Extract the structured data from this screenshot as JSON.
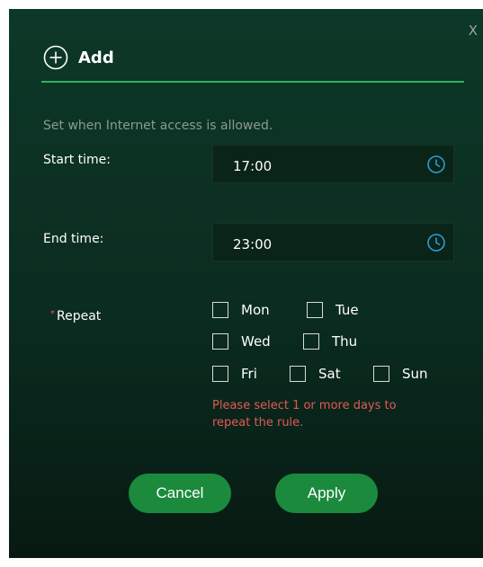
{
  "dialog": {
    "title": "Add",
    "close_label": "X",
    "intro": "Set when Internet access is allowed."
  },
  "start_time": {
    "label": "Start time:",
    "value": "17:00"
  },
  "end_time": {
    "label": "End time:",
    "value": "23:00"
  },
  "repeat": {
    "required_mark": "*",
    "label": "Repeat",
    "days": [
      {
        "label": "Mon",
        "checked": false
      },
      {
        "label": "Tue",
        "checked": false
      },
      {
        "label": "Wed",
        "checked": false
      },
      {
        "label": "Thu",
        "checked": false
      },
      {
        "label": "Fri",
        "checked": false
      },
      {
        "label": "Sat",
        "checked": false
      },
      {
        "label": "Sun",
        "checked": false
      }
    ],
    "error": "Please select 1 or more days to repeat the rule."
  },
  "buttons": {
    "cancel": "Cancel",
    "apply": "Apply"
  },
  "colors": {
    "accent": "#31b25a",
    "button": "#1b8a3d",
    "error": "#e25a55",
    "clock_icon": "#2a9dd6"
  },
  "icons": {
    "add": "plus-circle-icon",
    "time": "clock-icon"
  }
}
